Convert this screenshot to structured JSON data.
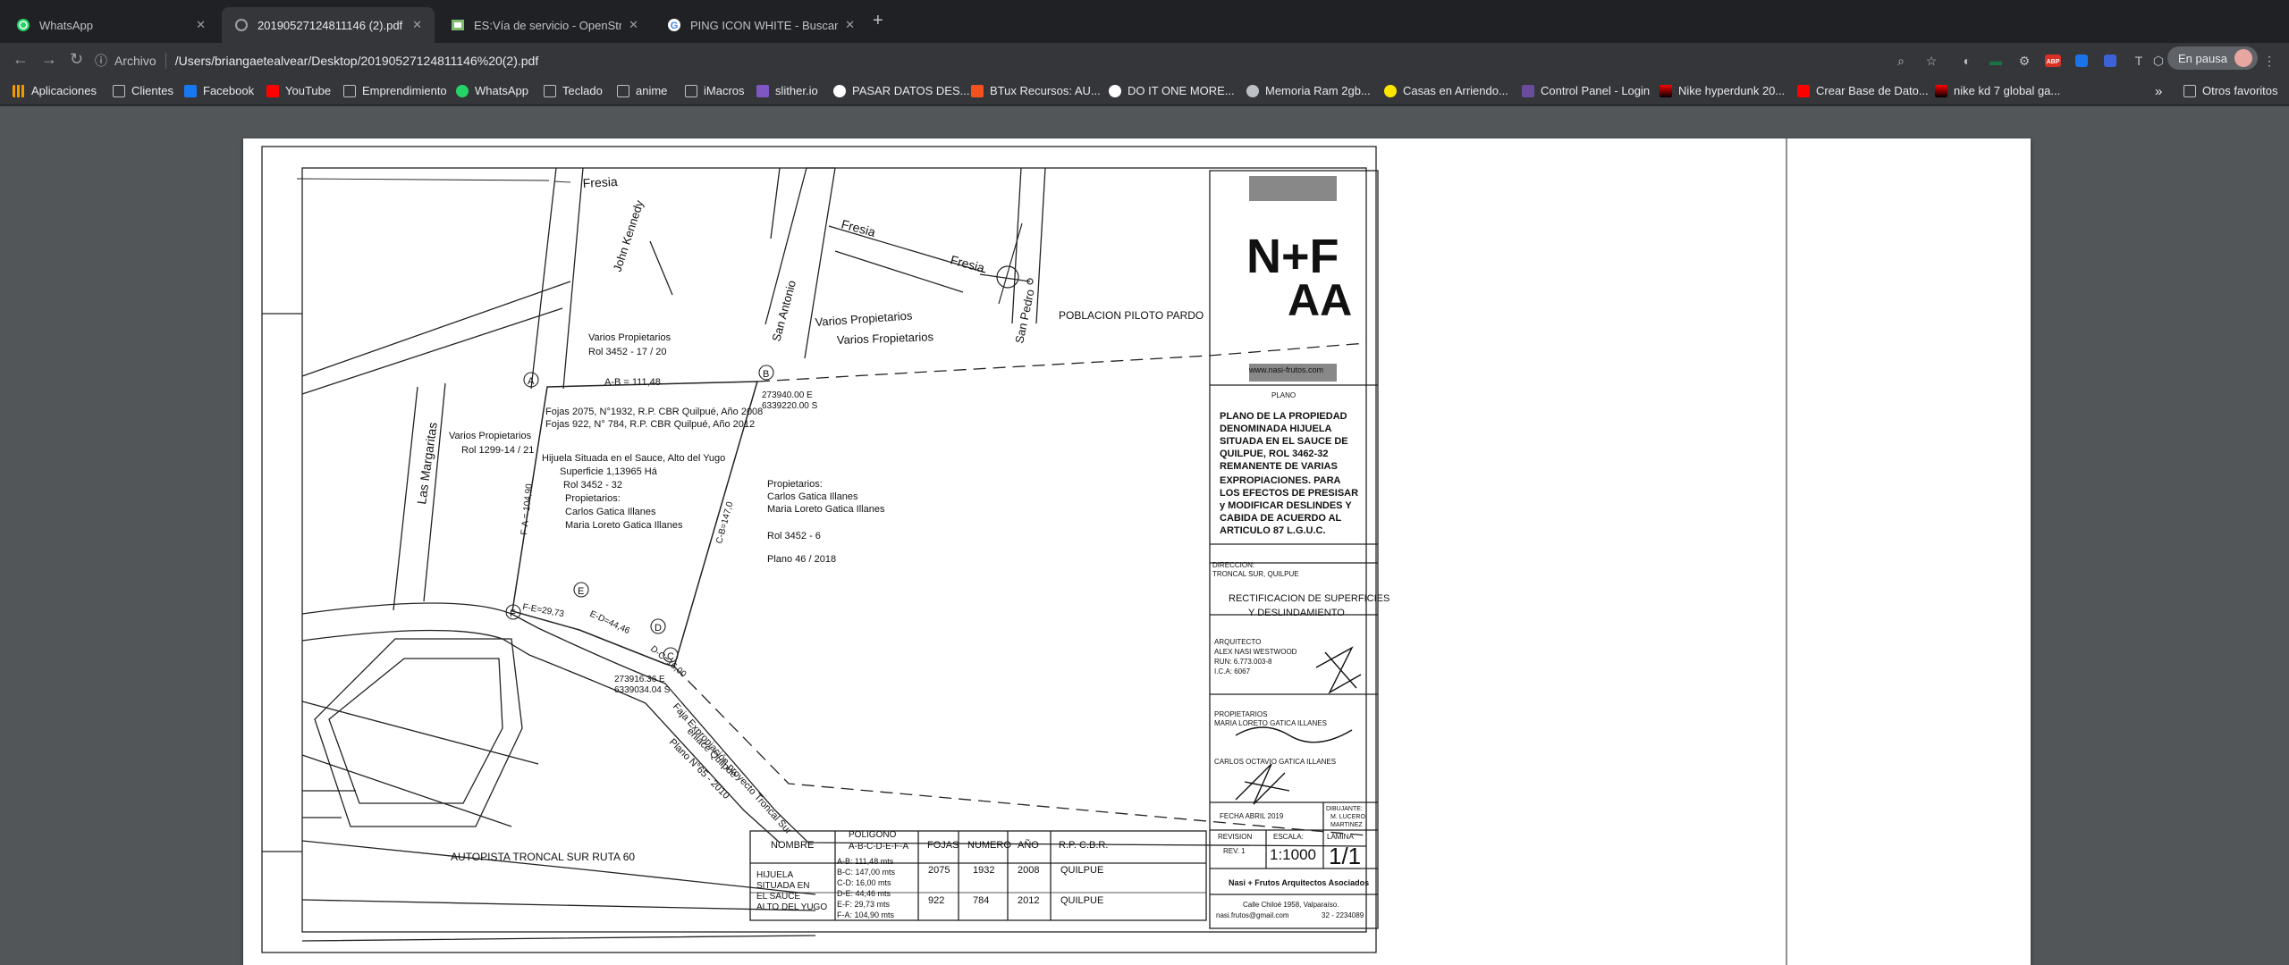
{
  "tabs": [
    {
      "title": "WhatsApp",
      "icon": "whatsapp-icon"
    },
    {
      "title": "20190527124811146 (2).pdf",
      "icon": "pdf-icon"
    },
    {
      "title": "ES:Vía de servicio - OpenStreetMap",
      "icon": "osm-icon"
    },
    {
      "title": "PING ICON WHITE - Buscar con Google",
      "icon": "google-icon"
    }
  ],
  "toolbar": {
    "site_label": "Archivo",
    "url": "/Users/briangaetealvear/Desktop/20190527124811146%20(2).pdf",
    "pause_label": "En pausa"
  },
  "bookmarks": [
    "Aplicaciones",
    "Clientes",
    "Facebook",
    "YouTube",
    "Emprendimiento",
    "WhatsApp",
    "Teclado",
    "anime",
    "iMacros",
    "slither.io",
    "PASAR DATOS DES...",
    "BTux Recursos: AU...",
    "DO IT ONE MORE...",
    "Memoria Ram 2gb...",
    "Casas en Arriendo...",
    "Control Panel - Login",
    "Nike hyperdunk 20...",
    "Crear Base de Dato...",
    "nike kd 7 global ga..."
  ],
  "bookmarks_more": "»",
  "other_bookmarks": "Otros favoritos",
  "plan": {
    "streets": {
      "fresia1": "Fresia",
      "fresia2": "Fresia",
      "fresia3": "Fresia",
      "kennedy": "John Kennedy",
      "san_antonio": "San Antonio",
      "san_pedro": "San Pedro",
      "margaritas": "Las Margaritas"
    },
    "poblacion": "POBLACION  PILOTO PARDO",
    "varios_top": "Varios   Propietarios",
    "varios_top2": "Varios   Fropietarios",
    "varios_a1": "Varios Propietarios",
    "varios_a2": "Rol  3452 - 17 / 20",
    "varios_b1": "Varios Propietarios",
    "varios_b2": "Rol  1299-14 / 21",
    "points": {
      "A": "A",
      "B": "B",
      "C": "C",
      "D": "D",
      "E": "E",
      "F": "F"
    },
    "ab": "A-B = 111,48",
    "cb": "C-B=147,0",
    "fa": "F-A = 104,90",
    "fe": "F-E=29,73",
    "ed": "E-D=44,46",
    "dc": "D-C=16,00",
    "coordB1": "273940.00  E",
    "coordB2": "6339220.00  S",
    "coordC1": "273916.36   E",
    "coordC2": "6339034.04  S",
    "fojas1": "Fojas 2075, N°1932, R.P. CBR  Quilpué, Año 2008",
    "fojas2": "Fojas 922,  N° 784, R.P. CBR Quilpué, Año 2012",
    "hij1": "Hijuela Situada en el Sauce, Alto  del Yugo",
    "hij2": "Superficie  1,13965 Há",
    "hij3": "Rol  3452 - 32",
    "hij4": "Propietarios:",
    "hij5": "Carlos Gatica Illanes",
    "hij6": "Maria Loreto Gatica Illanes",
    "prop1": "Propietarios:",
    "prop2": "Carlos Gatica Illanes",
    "prop3": "Maria Loreto Gatica Illanes",
    "prop4": "Rol  3452 - 6",
    "prop5": "Plano  46 / 2018",
    "faja1": "Faja Expropiación proyecto Troncal Sur",
    "faja2": "enlace Quilpué",
    "faja3": "Plano N°65 - 2010",
    "autopista": "AUTOPISTA TRONCAL SUR RUTA 60",
    "table": {
      "headers": [
        "NOMBRE",
        "POLIGONO",
        "A-B-C-D-E-F-A",
        "FOJAS",
        "NUMERO",
        "AÑO",
        "R.P. C.B.R."
      ],
      "name": [
        "HIJUELA",
        "SITUADA EN",
        "EL SAUCE",
        "ALTO DEL YUGO"
      ],
      "poly": [
        "A-B: 111,48 mts",
        "B-C: 147,00 mts",
        "C-D:  16,00 mts",
        "D-E:  44,46 mts",
        "E-F:  29,73 mts",
        "F-A: 104,90 mts"
      ],
      "rows": [
        [
          "2075",
          "1932",
          "2008",
          "QUILPUE"
        ],
        [
          "922",
          "784",
          "2012",
          "QUILPUE"
        ]
      ]
    },
    "cartouche": {
      "logo1": "N+F",
      "logo2": "AA",
      "web": "www.nasi-frutos.com",
      "plano": "PLANO",
      "title": [
        "PLANO DE LA PROPIEDAD",
        "DENOMINADA HIJUELA",
        "SITUADA EN EL SAUCE DE",
        "QUILPUE, ROL 3462-32",
        "REMANENTE DE VARIAS"
      ],
      "title2": [
        "EXPROPIACIONES. PARA",
        "LOS EFECTOS DE PRESISAR",
        "y MODIFICAR DESLINDES Y",
        "CABIDA DE ACUERDO AL",
        "ARTICULO 87 L.G.U.C."
      ],
      "dir1": "DIRECCION:",
      "dir2": "TRONCAL SUR, QUILPUE",
      "rect1": "RECTIFICACION DE SUPERFICIES",
      "rect2": "Y DESLINDAMIENTO",
      "arq": [
        "ARQUITECTO",
        "ALEX NASI WESTWOOD",
        "RUN: 6.773.003-8",
        "I.C.A: 6067"
      ],
      "props": "PROPIETARIOS",
      "prop_a": "MARIA LORETO GATICA ILLANES",
      "prop_b": "CARLOS OCTAVIO GATICA ILLANES",
      "fecha": "FECHA    ABRIL 2019",
      "dibujo": [
        "DIBUJANTE:",
        "M. LUCERO",
        "MARTINEZ"
      ],
      "revision": "REVISION",
      "rev": "REV. 1",
      "escala": "ESCALA:",
      "escala_v": "1:1000",
      "lamina": "LAMINA",
      "lamina_v": "1/1",
      "firm": "Nasi + Frutos Arquitectos Asociados",
      "addr": "Calle Chiloé  1958,  Valparaíso.",
      "mail": "nasi.frutos@gmail.com",
      "phone": "32 - 2234089"
    }
  }
}
